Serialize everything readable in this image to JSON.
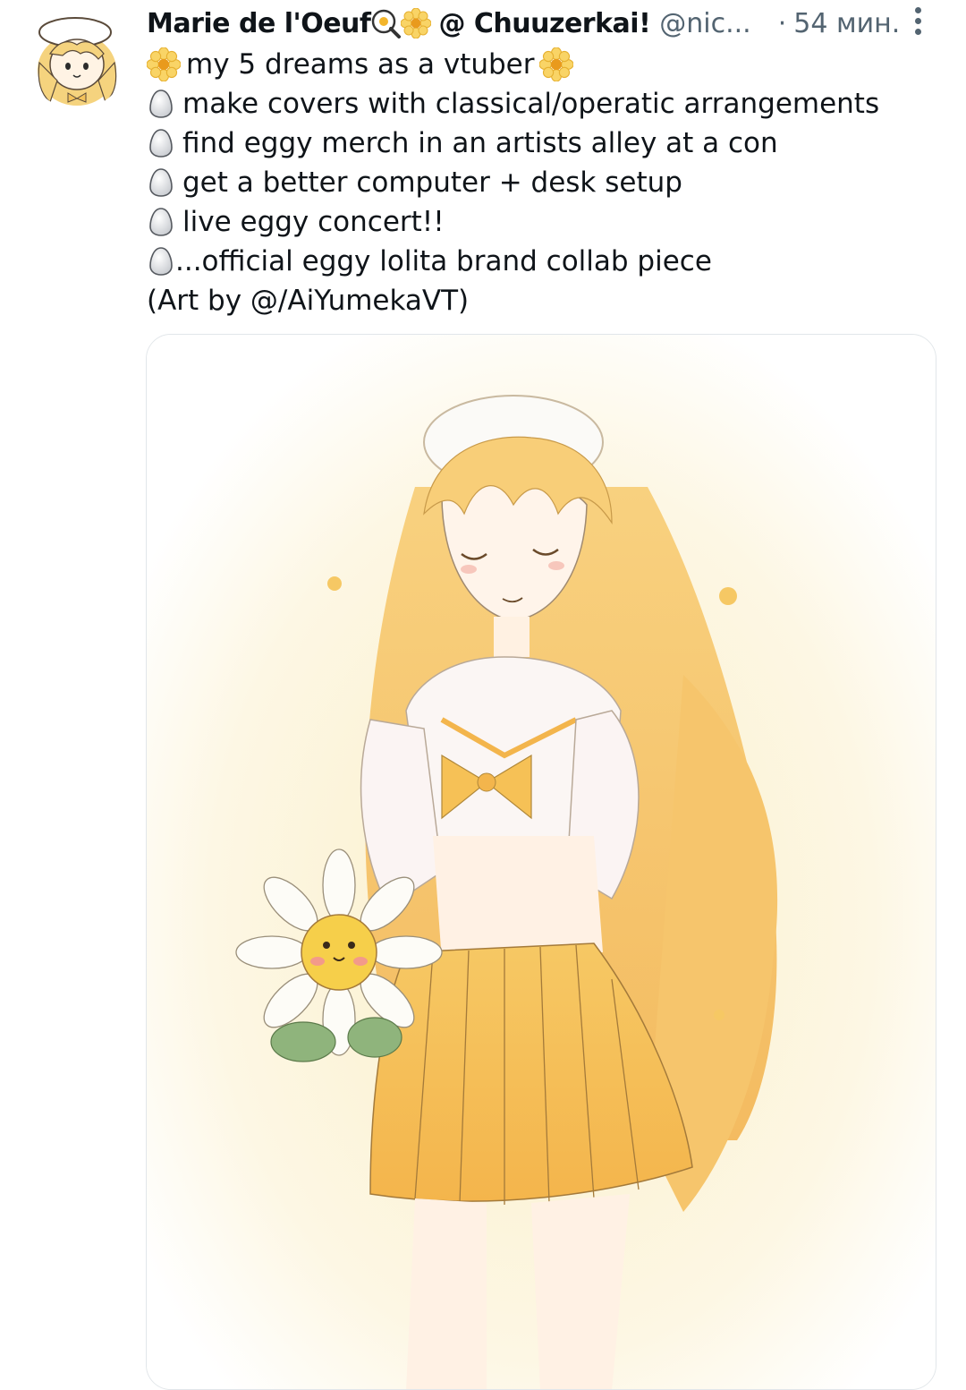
{
  "author": {
    "display_name": "Marie de l'Oeuf",
    "name_suffix": "@ Chuuzerkai!",
    "handle": "@nic...",
    "separator": "·",
    "time": "54 мин."
  },
  "icons": {
    "avatar": "avatar-chibi",
    "name_emoji_1": "fried-egg-pan-icon",
    "name_emoji_2": "daisy-icon",
    "more": "more-vertical-icon",
    "list_bullet": "egg-icon"
  },
  "post": {
    "heading": "my 5 dreams as a vtuber",
    "items": [
      "make covers with classical/operatic arrangements",
      "find eggy merch in an artists alley at a con",
      "get a better computer + desk setup",
      "live eggy concert!!",
      "...official eggy lolita brand collab piece"
    ],
    "credit": "(Art by @/AiYumekaVT)"
  },
  "colors": {
    "text": "#0f1419",
    "secondary": "#536471",
    "media_border": "#e1e6ea",
    "accent_yellow": "#f3c25b"
  }
}
